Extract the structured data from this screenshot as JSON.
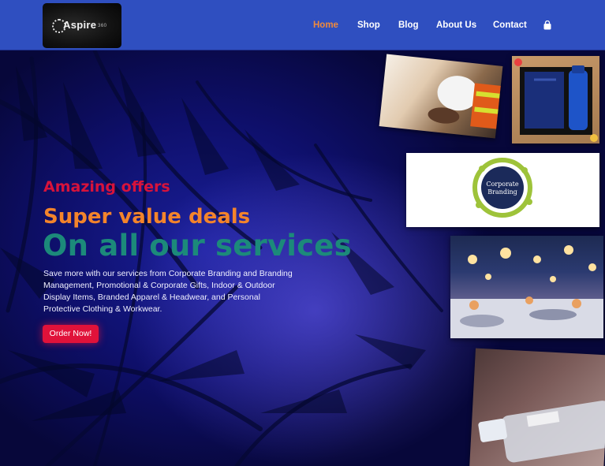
{
  "header": {
    "logo": {
      "text": "Aspire",
      "sub": "360"
    },
    "nav": [
      {
        "label": "Home",
        "active": true
      },
      {
        "label": "Shop",
        "active": false
      },
      {
        "label": "Blog",
        "active": false
      },
      {
        "label": "About Us",
        "active": false
      },
      {
        "label": "Contact",
        "active": false
      }
    ],
    "cart_icon": "shopping-bag-icon"
  },
  "hero": {
    "tagline_1": "Amazing offers",
    "tagline_2": "Super value deals",
    "headline": "On all our services",
    "description": "Save more with our services from Corporate Branding and Branding Management, Promotional & Corporate Gifts, Indoor & Outdoor Display Items, Branded Apparel & Headwear, and Personal Protective Clothing & Workwear.",
    "cta_label": "Order Now!"
  },
  "gallery": {
    "branding_badge": {
      "line1": "Corporate",
      "line2": "Branding"
    }
  },
  "colors": {
    "header_bg": "#2f4fc0",
    "nav_active": "#f08a3c",
    "tagline_1": "#d7133b",
    "tagline_2": "#f3842b",
    "headline": "#1c8a7a",
    "cta_bg": "#e0123a"
  }
}
